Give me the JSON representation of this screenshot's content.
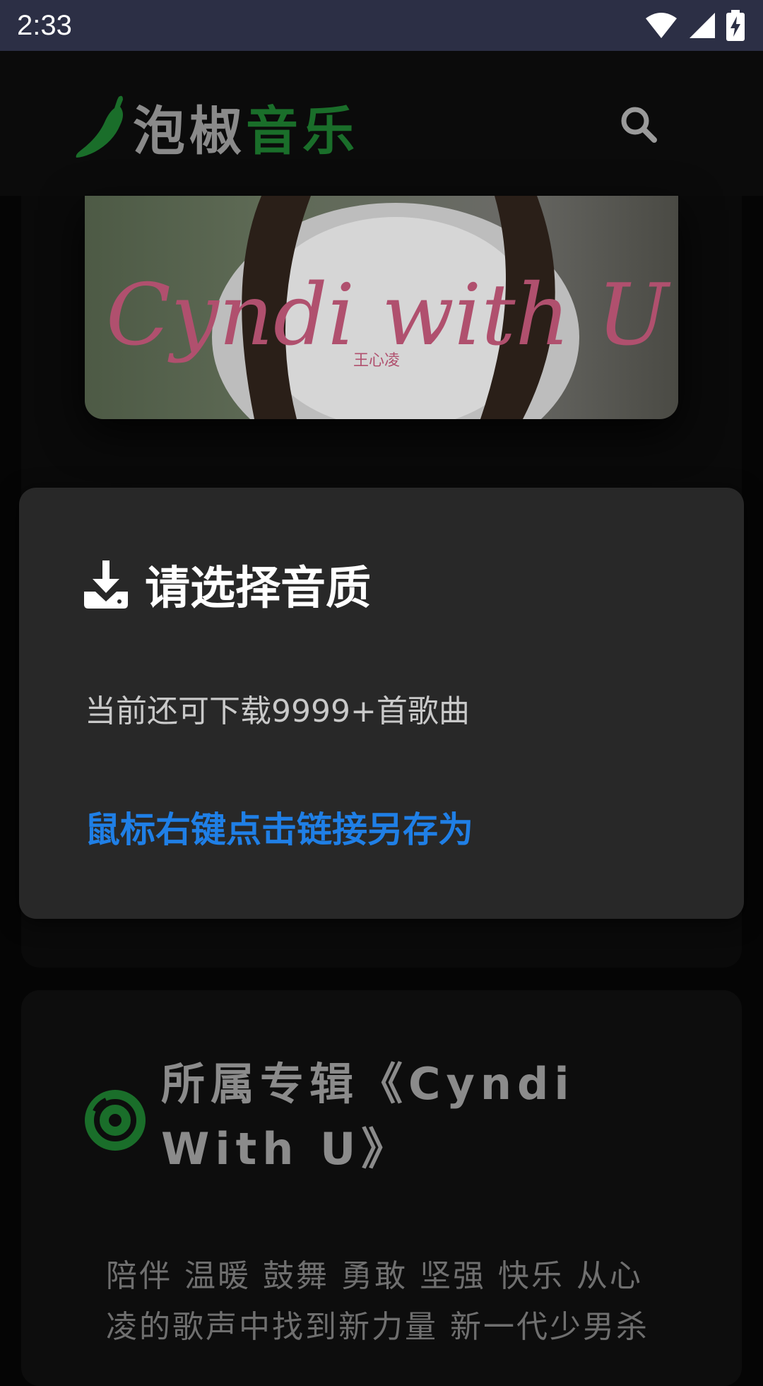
{
  "status_bar": {
    "time": "2:33",
    "icons": [
      "wifi-icon",
      "cell-signal-icon",
      "battery-charging-icon"
    ]
  },
  "header": {
    "brand_part1": "泡椒",
    "brand_part2": "音乐",
    "logo_icon": "chili-pepper-icon",
    "search_icon": "search-icon",
    "brand_color": "#1a6e2a"
  },
  "cover": {
    "album_art_text": "Cyndi with U",
    "album_art_subtext": "王心凌"
  },
  "dialog": {
    "icon": "download-icon",
    "title": "请选择音质",
    "remaining_text": "当前还可下载9999+首歌曲",
    "save_link_text": "鼠标右键点击链接另存为",
    "link_color": "#1f7fe6"
  },
  "album": {
    "icon": "disc-icon",
    "title": "所属专辑《Cyndi With U》",
    "description_line1": "陪伴 温暖 鼓舞 勇敢 坚强 快乐 从心",
    "description_line2": "凌的歌声中找到新力量 新一代少男杀"
  }
}
